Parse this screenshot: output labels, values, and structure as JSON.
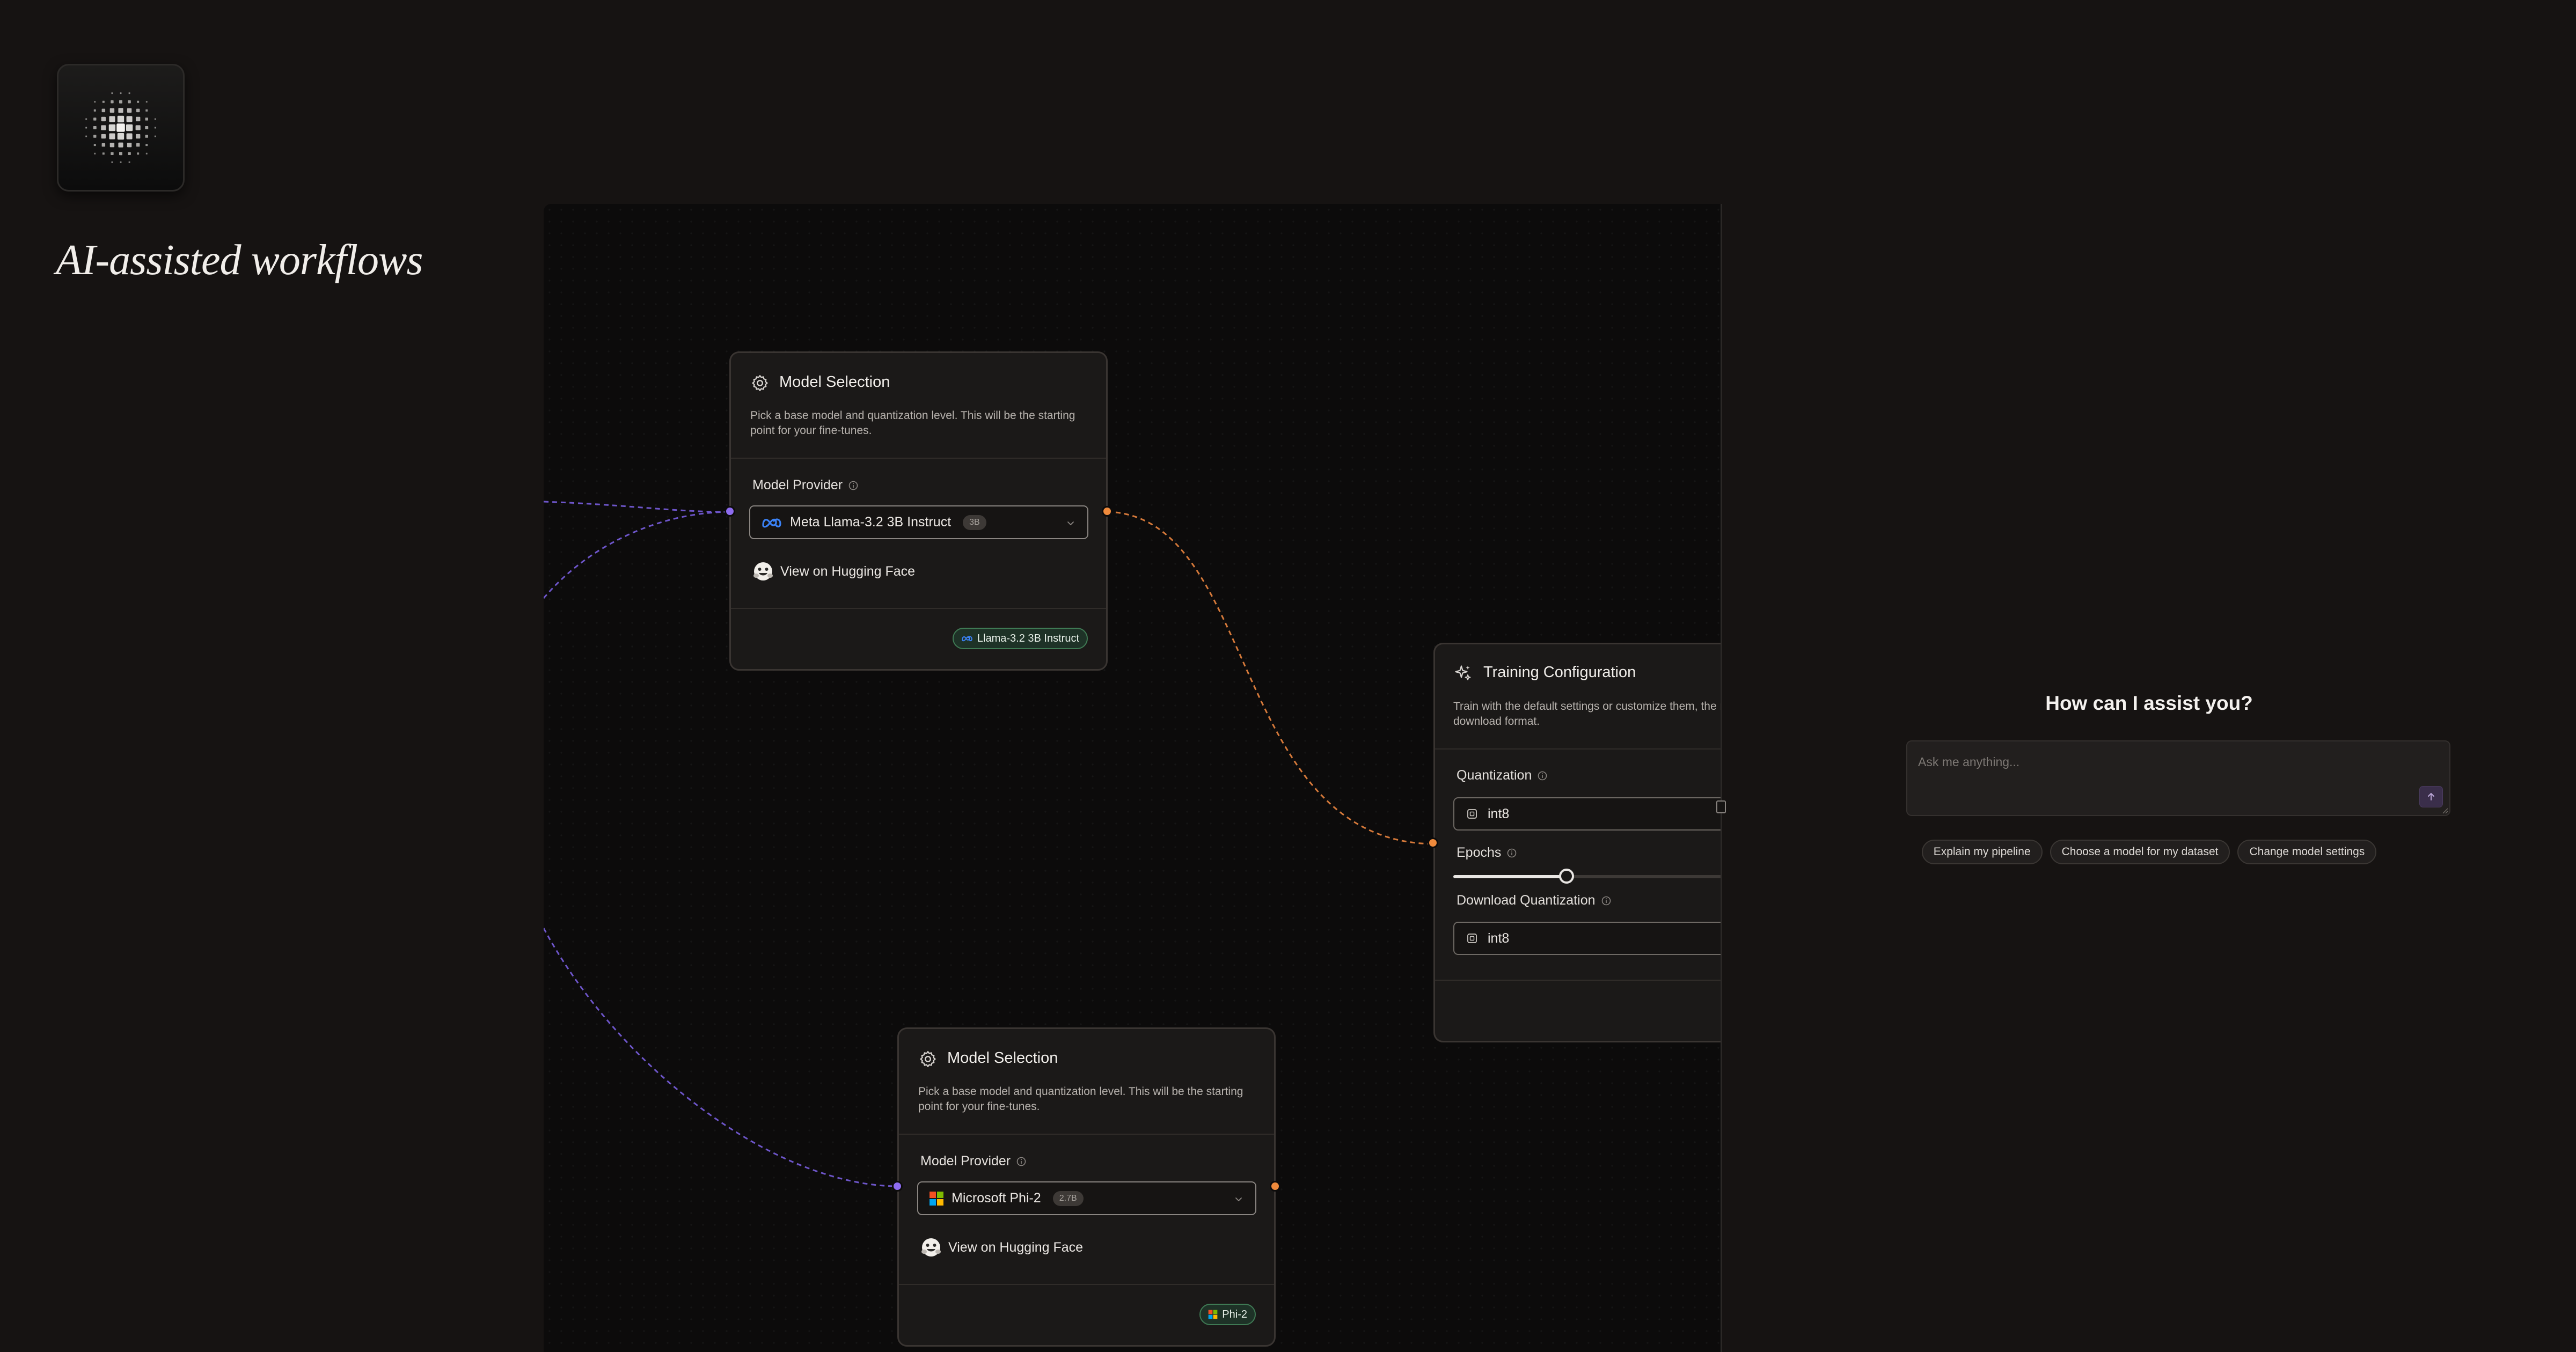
{
  "headline": "AI-assisted workflows",
  "colors": {
    "background": "#161312",
    "canvas": "#0c0b0b",
    "input_handle": "#8e6cf0",
    "output_handle": "#ef8a3c",
    "output_badge_border": "#3f7a54"
  },
  "nodes": [
    {
      "title": "Model Selection",
      "icon": "gear-icon",
      "description": "Pick a base model and quantization level. This will be the starting point for your fine-tunes.",
      "field_label": "Model Provider",
      "selected_model": "Meta Llama-3.2 3B Instruct",
      "model_icon": "meta-icon",
      "size_badge": "3B",
      "link_label": "View on Hugging Face",
      "output_badge": "Llama-3.2 3B Instruct"
    },
    {
      "title": "Model Selection",
      "icon": "gear-icon",
      "description": "Pick a base model and quantization level. This will be the starting point for your fine-tunes.",
      "field_label": "Model Provider",
      "selected_model": "Microsoft Phi-2",
      "model_icon": "microsoft-icon",
      "size_badge": "2.7B",
      "link_label": "View on Hugging Face",
      "output_badge": "Phi-2"
    }
  ],
  "training": {
    "title": "Training Configuration",
    "icon": "sparkle-icon",
    "description": "Train with the default settings or customize them, the model download format.",
    "quantization_label": "Quantization",
    "quantization_value": "int8",
    "epochs_label": "Epochs",
    "epochs_fill": 0.33,
    "download_label": "Download Quantization",
    "download_value": "int8"
  },
  "chat": {
    "title": "How can I assist you?",
    "placeholder": "Ask me anything...",
    "suggestions": [
      "Explain my pipeline",
      "Choose a model for my dataset",
      "Change model settings"
    ]
  }
}
